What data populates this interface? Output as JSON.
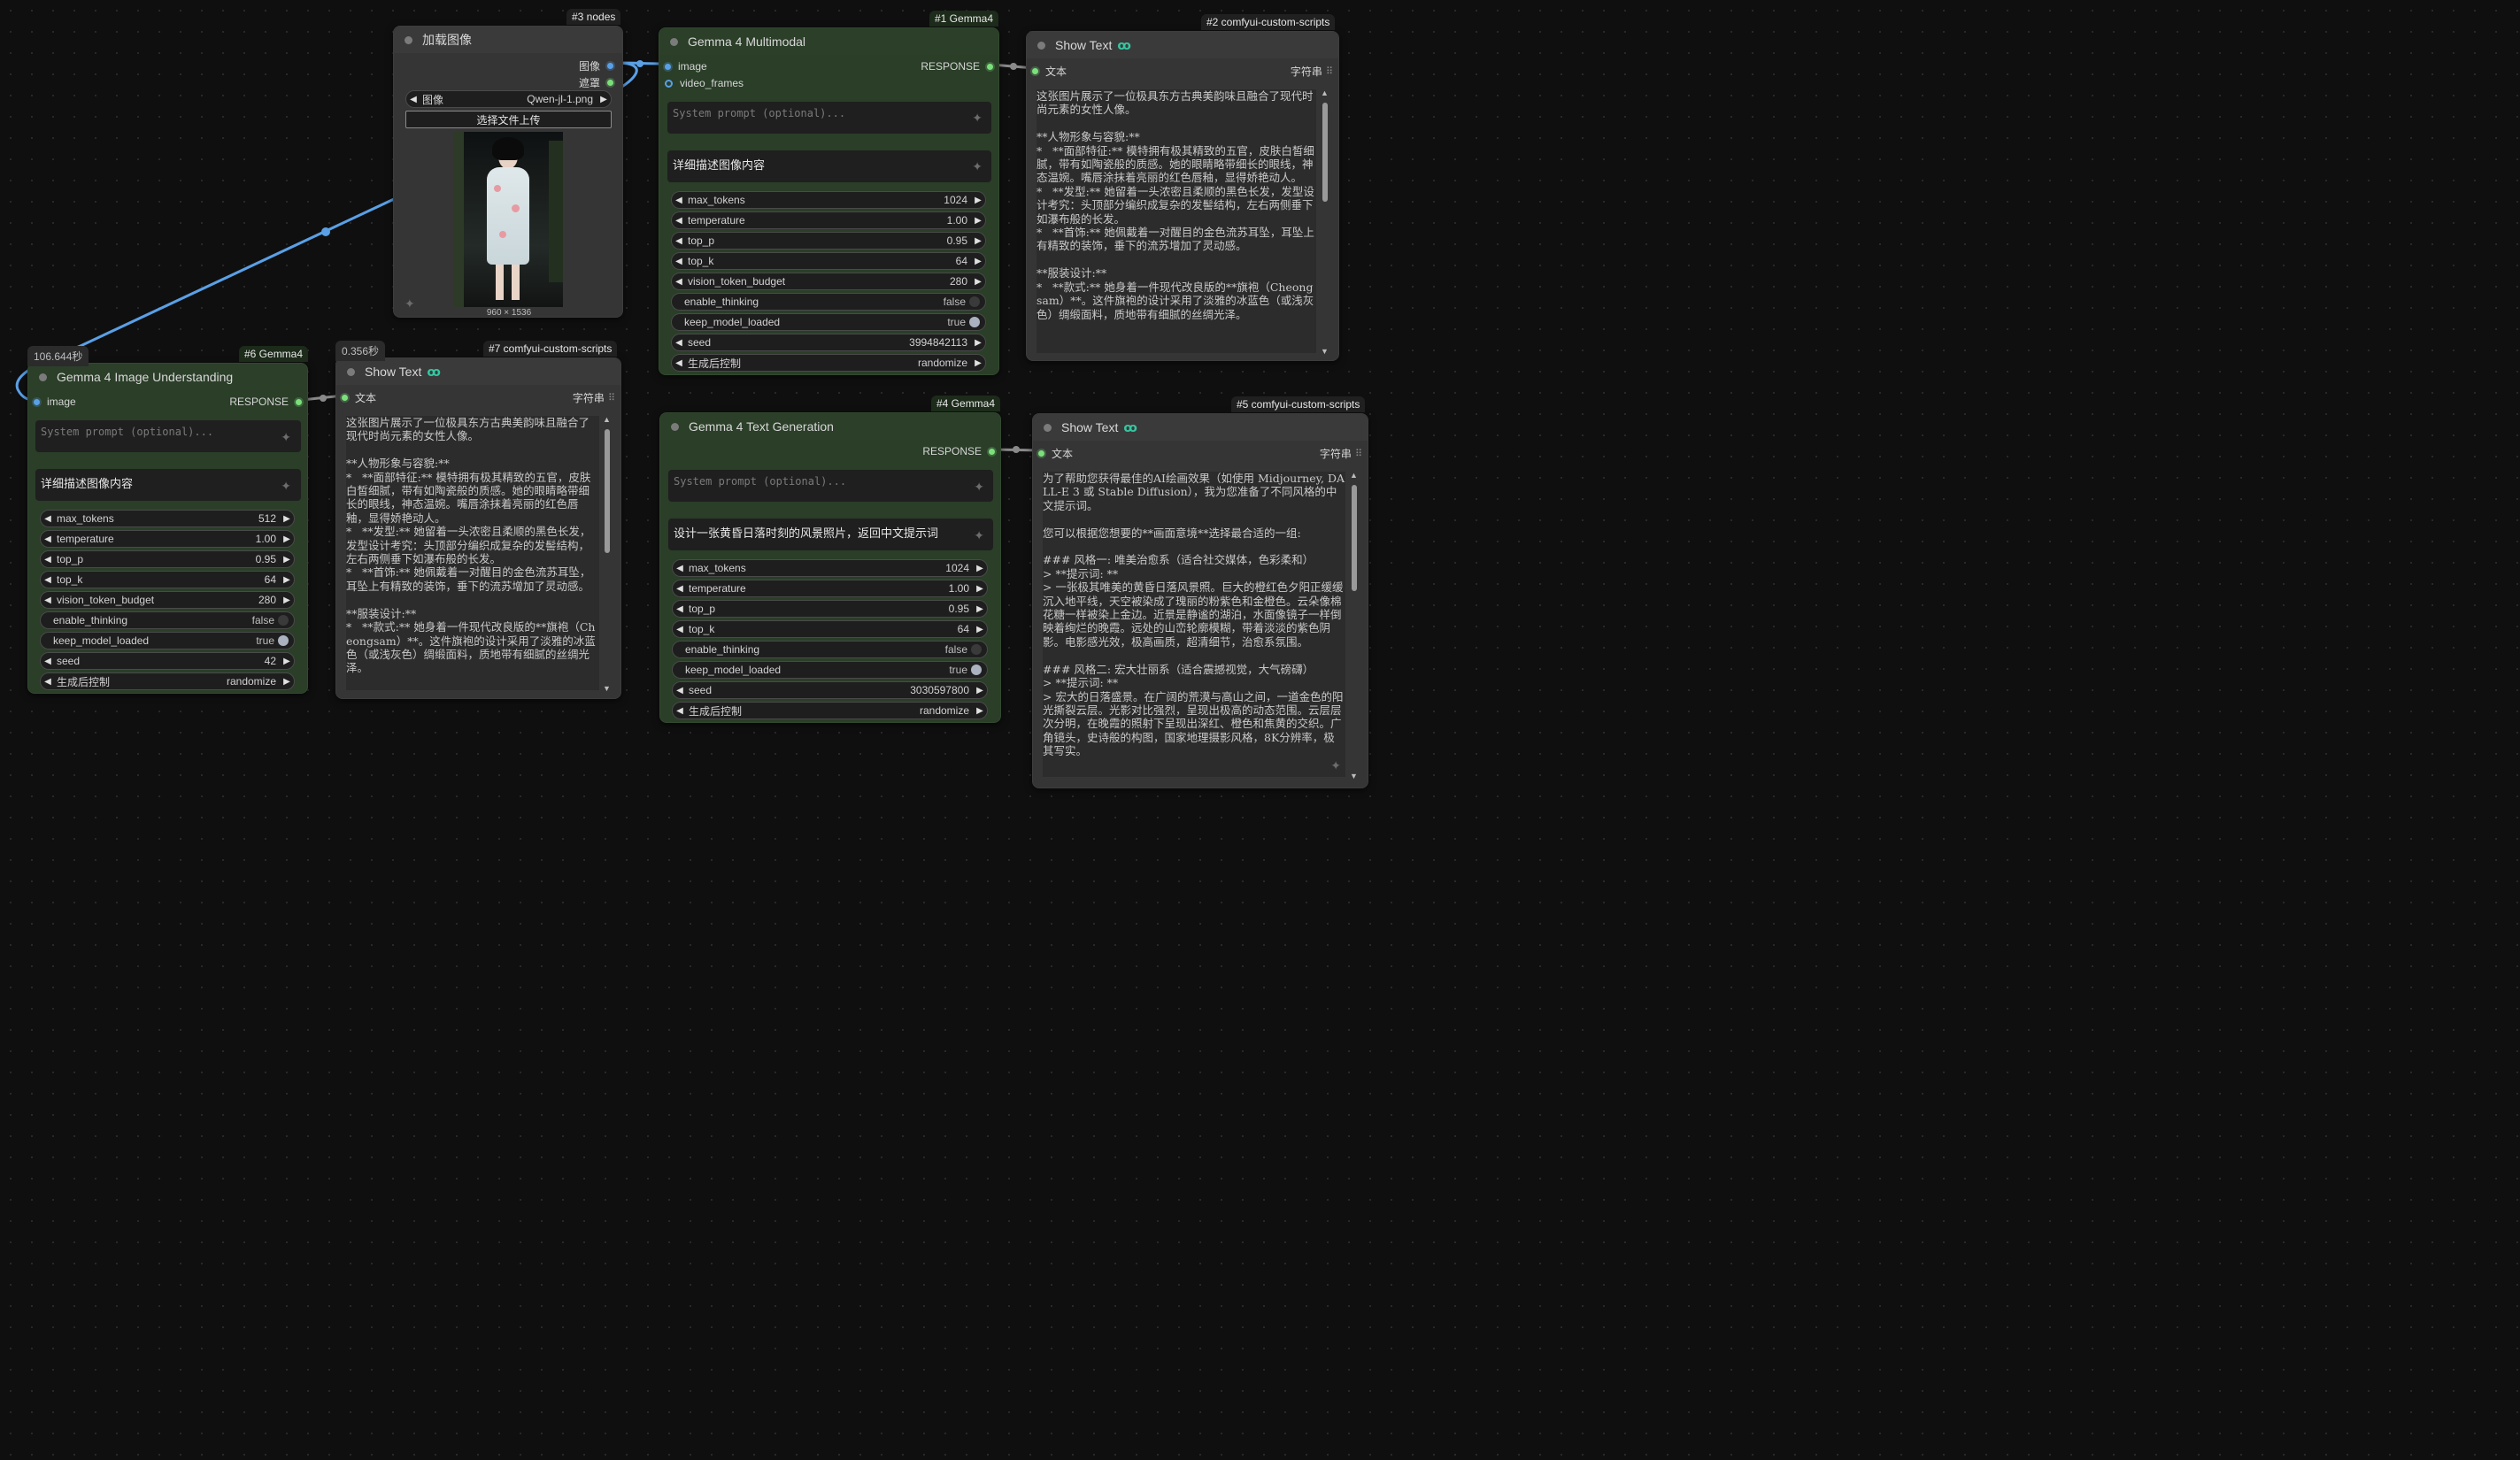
{
  "badges": {
    "n3": "#3 nodes",
    "n1": "#1 Gemma4",
    "n2": "#2 comfyui-custom-scripts",
    "n6": "#6 Gemma4",
    "n7": "#7 comfyui-custom-scripts",
    "n4": "#4 Gemma4",
    "n5": "#5 comfyui-custom-scripts"
  },
  "timers": {
    "n6": "106.644秒",
    "n7": "0.356秒"
  },
  "colors": {
    "wire_blue": "#5aa0e6",
    "wire_gray": "#8a8a8a",
    "node_green": "#2a3e28",
    "node_gray": "#353535"
  },
  "load_image": {
    "title": "加载图像",
    "outputs": [
      "图像",
      "遮罩"
    ],
    "image_widget": {
      "label": "图像",
      "value": "Qwen-jl-1.png"
    },
    "upload_button": "选择文件上传",
    "dimensions": "960 × 1536"
  },
  "n1": {
    "title": "Gemma 4 Multimodal",
    "inputs": [
      "image",
      "video_frames"
    ],
    "output": "RESPONSE",
    "system_placeholder": "System prompt (optional)...",
    "prompt": "详细描述图像内容",
    "widgets": [
      {
        "label": "max_tokens",
        "value": "1024"
      },
      {
        "label": "temperature",
        "value": "1.00"
      },
      {
        "label": "top_p",
        "value": "0.95"
      },
      {
        "label": "top_k",
        "value": "64"
      },
      {
        "label": "vision_token_budget",
        "value": "280"
      },
      {
        "label": "enable_thinking",
        "value": "false",
        "toggle": true,
        "on": false
      },
      {
        "label": "keep_model_loaded",
        "value": "true",
        "toggle": true,
        "on": true
      },
      {
        "label": "seed",
        "value": "3994842113"
      },
      {
        "label": "生成后控制",
        "value": "randomize"
      }
    ]
  },
  "n2": {
    "title": "Show Text",
    "input": "文本",
    "type_label": "字符串",
    "text": "这张图片展示了一位极具东方古典美韵味且融合了现代时尚元素的女性人像。\n\n**人物形象与容貌:**\n*   **面部特征:** 模特拥有极其精致的五官，皮肤白皙细腻，带有如陶瓷般的质感。她的眼睛略带细长的眼线，神态温婉。嘴唇涂抹着亮丽的红色唇釉，显得娇艳动人。\n*   **发型:** 她留着一头浓密且柔顺的黑色长发，发型设计考究：头顶部分编织成复杂的发髻结构，左右两侧垂下如瀑布般的长发。\n*   **首饰:** 她佩戴着一对醒目的金色流苏耳坠，耳坠上有精致的装饰，垂下的流苏增加了灵动感。\n\n**服装设计:**\n*   **款式:** 她身着一件现代改良版的**旗袍（Cheongsam）**。这件旗袍的设计采用了淡雅的冰蓝色（或浅灰色）绸缎面料，质地带有细腻的丝绸光泽。"
  },
  "n6": {
    "title": "Gemma 4 Image Understanding",
    "input": "image",
    "output": "RESPONSE",
    "system_placeholder": "System prompt (optional)...",
    "prompt": "详细描述图像内容",
    "widgets": [
      {
        "label": "max_tokens",
        "value": "512"
      },
      {
        "label": "temperature",
        "value": "1.00"
      },
      {
        "label": "top_p",
        "value": "0.95"
      },
      {
        "label": "top_k",
        "value": "64"
      },
      {
        "label": "vision_token_budget",
        "value": "280"
      },
      {
        "label": "enable_thinking",
        "value": "false",
        "toggle": true,
        "on": false
      },
      {
        "label": "keep_model_loaded",
        "value": "true",
        "toggle": true,
        "on": true
      },
      {
        "label": "seed",
        "value": "42"
      },
      {
        "label": "生成后控制",
        "value": "randomize"
      }
    ]
  },
  "n7": {
    "title": "Show Text",
    "input": "文本",
    "type_label": "字符串",
    "text": "这张图片展示了一位极具东方古典美韵味且融合了现代时尚元素的女性人像。\n\n**人物形象与容貌:**\n*   **面部特征:** 模特拥有极其精致的五官，皮肤白皙细腻，带有如陶瓷般的质感。她的眼睛略带细长的眼线，神态温婉。嘴唇涂抹着亮丽的红色唇釉，显得娇艳动人。\n*   **发型:** 她留着一头浓密且柔顺的黑色长发，发型设计考究：头顶部分编织成复杂的发髻结构，左右两侧垂下如瀑布般的长发。\n*   **首饰:** 她佩戴着一对醒目的金色流苏耳坠，耳坠上有精致的装饰，垂下的流苏增加了灵动感。\n\n**服装设计:**\n*   **款式:** 她身着一件现代改良版的**旗袍（Cheongsam）**。这件旗袍的设计采用了淡雅的冰蓝色（或浅灰色）绸缎面料，质地带有细腻的丝绸光泽。"
  },
  "n4": {
    "title": "Gemma 4 Text Generation",
    "output": "RESPONSE",
    "system_placeholder": "System prompt (optional)...",
    "prompt": "设计一张黄昏日落时刻的风景照片，返回中文提示词",
    "widgets": [
      {
        "label": "max_tokens",
        "value": "1024"
      },
      {
        "label": "temperature",
        "value": "1.00"
      },
      {
        "label": "top_p",
        "value": "0.95"
      },
      {
        "label": "top_k",
        "value": "64"
      },
      {
        "label": "enable_thinking",
        "value": "false",
        "toggle": true,
        "on": false
      },
      {
        "label": "keep_model_loaded",
        "value": "true",
        "toggle": true,
        "on": true
      },
      {
        "label": "seed",
        "value": "3030597800"
      },
      {
        "label": "生成后控制",
        "value": "randomize"
      }
    ]
  },
  "n5": {
    "title": "Show Text",
    "input": "文本",
    "type_label": "字符串",
    "text": "为了帮助您获得最佳的AI绘画效果（如使用 Midjourney, DALL-E 3 或 Stable Diffusion），我为您准备了不同风格的中文提示词。\n\n您可以根据您想要的**画面意境**选择最合适的一组:\n\n### 风格一: 唯美治愈系（适合社交媒体，色彩柔和）\n> **提示词: **\n> 一张极其唯美的黄昏日落风景照。巨大的橙红色夕阳正缓缓沉入地平线，天空被染成了瑰丽的粉紫色和金橙色。云朵像棉花糖一样被染上金边。近景是静谧的湖泊，水面像镜子一样倒映着绚烂的晚霞。远处的山峦轮廓模糊，带着淡淡的紫色阴影。电影感光效，极高画质，超清细节，治愈系氛围。\n\n### 风格二: 宏大壮丽系（适合震撼视觉，大气磅礴）\n> **提示词: **\n> 宏大的日落盛景。在广阔的荒漠与高山之间，一道金色的阳光撕裂云层。光影对比强烈，呈现出极高的动态范围。云层层次分明，在晚霞的照射下呈现出深红、橙色和焦黄的交织。广角镜头，史诗般的构图，国家地理摄影风格，8K分辨率，极其写实。"
  }
}
